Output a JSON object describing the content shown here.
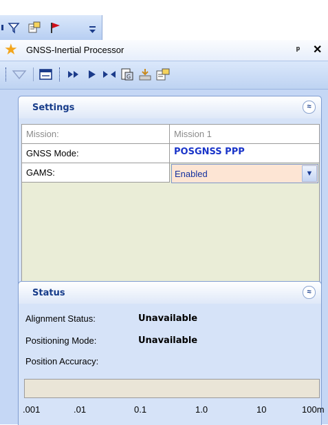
{
  "panel": {
    "title": "GNSS-Inertial Processor",
    "pin_glyph": "ᵖ",
    "close_glyph": "✕"
  },
  "settings": {
    "title": "Settings",
    "collapse_glyph": "≈",
    "rows": [
      {
        "label": "Mission:",
        "value": "Mission 1"
      },
      {
        "label": "GNSS Mode:",
        "value": "POSGNSS PPP"
      },
      {
        "label": "GAMS:",
        "value": "Enabled"
      }
    ]
  },
  "status": {
    "title": "Status",
    "collapse_glyph": "≈",
    "alignment_label": "Alignment Status:",
    "alignment_value": "Unavailable",
    "positioning_label": "Positioning Mode:",
    "positioning_value": "Unavailable",
    "accuracy_label": "Position Accuracy:",
    "scale": [
      ".001",
      ".01",
      "0.1",
      "1.0",
      "10",
      "100m"
    ]
  },
  "icons": [
    "filter-icon",
    "properties-icon",
    "flag-icon",
    "overflow-icon",
    "star-icon",
    "pin-icon",
    "close-icon",
    "back-icon",
    "window-icon",
    "fast-forward-icon",
    "play-icon",
    "step-icon",
    "report-icon",
    "export-icon",
    "settings-icon",
    "collapse-icon",
    "dropdown-icon"
  ],
  "colors": {
    "accent": "#1a35c9",
    "header": "#173c8a",
    "combo_bg": "#fde5d4",
    "panel_bg": "#c5d7f5"
  }
}
